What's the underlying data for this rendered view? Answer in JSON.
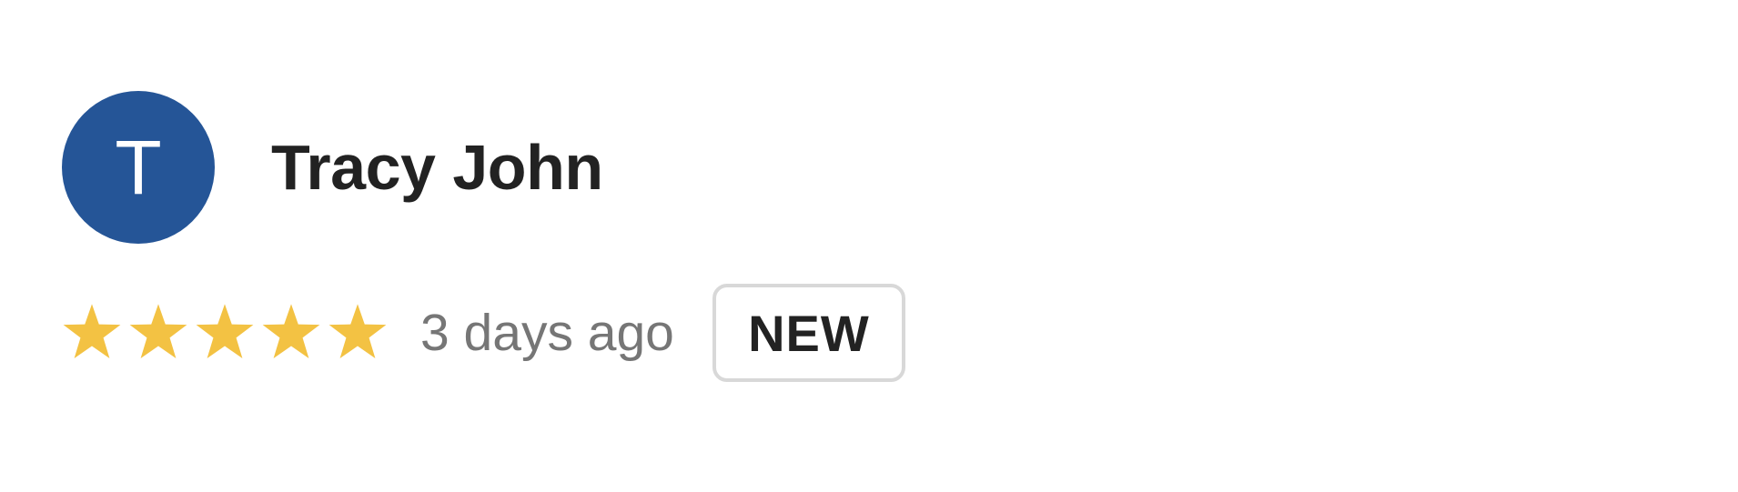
{
  "review": {
    "reviewer": {
      "initial": "T",
      "name": "Tracy John",
      "avatar_color": "#255597"
    },
    "rating": {
      "stars": 5,
      "max_stars": 5,
      "star_color": "#F3C243",
      "star_icon": "star-icon"
    },
    "time_ago": "3 days ago",
    "badge": "NEW"
  }
}
